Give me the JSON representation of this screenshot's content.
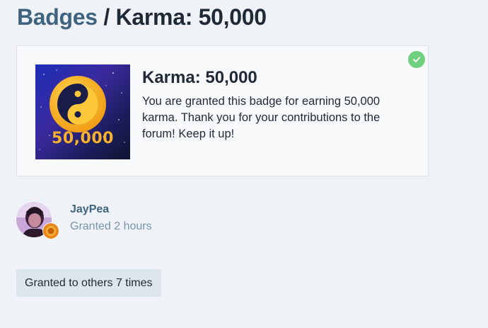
{
  "header": {
    "breadcrumb_link": "Badges",
    "separator": "/",
    "current": "Karma: 50,000"
  },
  "badge": {
    "name": "Karma: 50,000",
    "description": "You are granted this badge for earning 50,000 karma. Thank you for your contributions to the forum! Keep it up!",
    "image_label": "50,000",
    "granted_icon": "check-icon"
  },
  "grant": {
    "username": "JayPea",
    "granted_time": "Granted 2 hours"
  },
  "others": {
    "label": "Granted to others 7 times"
  },
  "colors": {
    "background": "#eff3f8",
    "link": "#40637f",
    "muted": "#7a93a8",
    "check": "#6fd07f",
    "card": "#f7f9fb"
  }
}
